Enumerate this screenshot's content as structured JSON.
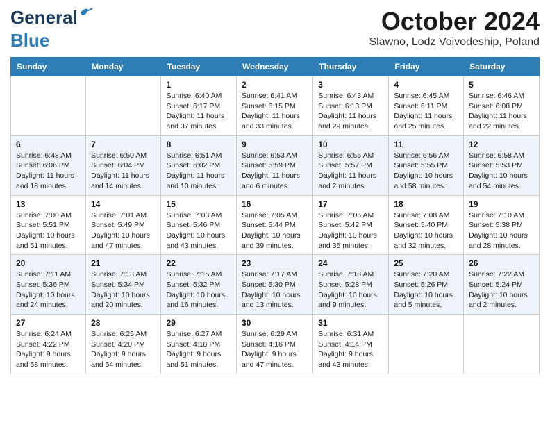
{
  "header": {
    "logo_line1": "General",
    "logo_line2": "Blue",
    "month_title": "October 2024",
    "location": "Slawno, Lodz Voivodeship, Poland"
  },
  "weekdays": [
    "Sunday",
    "Monday",
    "Tuesday",
    "Wednesday",
    "Thursday",
    "Friday",
    "Saturday"
  ],
  "weeks": [
    [
      {
        "day": null
      },
      {
        "day": null
      },
      {
        "day": "1",
        "sunrise": "6:40 AM",
        "sunset": "6:17 PM",
        "daylight": "11 hours and 37 minutes."
      },
      {
        "day": "2",
        "sunrise": "6:41 AM",
        "sunset": "6:15 PM",
        "daylight": "11 hours and 33 minutes."
      },
      {
        "day": "3",
        "sunrise": "6:43 AM",
        "sunset": "6:13 PM",
        "daylight": "11 hours and 29 minutes."
      },
      {
        "day": "4",
        "sunrise": "6:45 AM",
        "sunset": "6:11 PM",
        "daylight": "11 hours and 25 minutes."
      },
      {
        "day": "5",
        "sunrise": "6:46 AM",
        "sunset": "6:08 PM",
        "daylight": "11 hours and 22 minutes."
      }
    ],
    [
      {
        "day": "6",
        "sunrise": "6:48 AM",
        "sunset": "6:06 PM",
        "daylight": "11 hours and 18 minutes."
      },
      {
        "day": "7",
        "sunrise": "6:50 AM",
        "sunset": "6:04 PM",
        "daylight": "11 hours and 14 minutes."
      },
      {
        "day": "8",
        "sunrise": "6:51 AM",
        "sunset": "6:02 PM",
        "daylight": "11 hours and 10 minutes."
      },
      {
        "day": "9",
        "sunrise": "6:53 AM",
        "sunset": "5:59 PM",
        "daylight": "11 hours and 6 minutes."
      },
      {
        "day": "10",
        "sunrise": "6:55 AM",
        "sunset": "5:57 PM",
        "daylight": "11 hours and 2 minutes."
      },
      {
        "day": "11",
        "sunrise": "6:56 AM",
        "sunset": "5:55 PM",
        "daylight": "10 hours and 58 minutes."
      },
      {
        "day": "12",
        "sunrise": "6:58 AM",
        "sunset": "5:53 PM",
        "daylight": "10 hours and 54 minutes."
      }
    ],
    [
      {
        "day": "13",
        "sunrise": "7:00 AM",
        "sunset": "5:51 PM",
        "daylight": "10 hours and 51 minutes."
      },
      {
        "day": "14",
        "sunrise": "7:01 AM",
        "sunset": "5:49 PM",
        "daylight": "10 hours and 47 minutes."
      },
      {
        "day": "15",
        "sunrise": "7:03 AM",
        "sunset": "5:46 PM",
        "daylight": "10 hours and 43 minutes."
      },
      {
        "day": "16",
        "sunrise": "7:05 AM",
        "sunset": "5:44 PM",
        "daylight": "10 hours and 39 minutes."
      },
      {
        "day": "17",
        "sunrise": "7:06 AM",
        "sunset": "5:42 PM",
        "daylight": "10 hours and 35 minutes."
      },
      {
        "day": "18",
        "sunrise": "7:08 AM",
        "sunset": "5:40 PM",
        "daylight": "10 hours and 32 minutes."
      },
      {
        "day": "19",
        "sunrise": "7:10 AM",
        "sunset": "5:38 PM",
        "daylight": "10 hours and 28 minutes."
      }
    ],
    [
      {
        "day": "20",
        "sunrise": "7:11 AM",
        "sunset": "5:36 PM",
        "daylight": "10 hours and 24 minutes."
      },
      {
        "day": "21",
        "sunrise": "7:13 AM",
        "sunset": "5:34 PM",
        "daylight": "10 hours and 20 minutes."
      },
      {
        "day": "22",
        "sunrise": "7:15 AM",
        "sunset": "5:32 PM",
        "daylight": "10 hours and 16 minutes."
      },
      {
        "day": "23",
        "sunrise": "7:17 AM",
        "sunset": "5:30 PM",
        "daylight": "10 hours and 13 minutes."
      },
      {
        "day": "24",
        "sunrise": "7:18 AM",
        "sunset": "5:28 PM",
        "daylight": "10 hours and 9 minutes."
      },
      {
        "day": "25",
        "sunrise": "7:20 AM",
        "sunset": "5:26 PM",
        "daylight": "10 hours and 5 minutes."
      },
      {
        "day": "26",
        "sunrise": "7:22 AM",
        "sunset": "5:24 PM",
        "daylight": "10 hours and 2 minutes."
      }
    ],
    [
      {
        "day": "27",
        "sunrise": "6:24 AM",
        "sunset": "4:22 PM",
        "daylight": "9 hours and 58 minutes."
      },
      {
        "day": "28",
        "sunrise": "6:25 AM",
        "sunset": "4:20 PM",
        "daylight": "9 hours and 54 minutes."
      },
      {
        "day": "29",
        "sunrise": "6:27 AM",
        "sunset": "4:18 PM",
        "daylight": "9 hours and 51 minutes."
      },
      {
        "day": "30",
        "sunrise": "6:29 AM",
        "sunset": "4:16 PM",
        "daylight": "9 hours and 47 minutes."
      },
      {
        "day": "31",
        "sunrise": "6:31 AM",
        "sunset": "4:14 PM",
        "daylight": "9 hours and 43 minutes."
      },
      {
        "day": null
      },
      {
        "day": null
      }
    ]
  ],
  "labels": {
    "sunrise_label": "Sunrise:",
    "sunset_label": "Sunset:",
    "daylight_label": "Daylight:"
  }
}
